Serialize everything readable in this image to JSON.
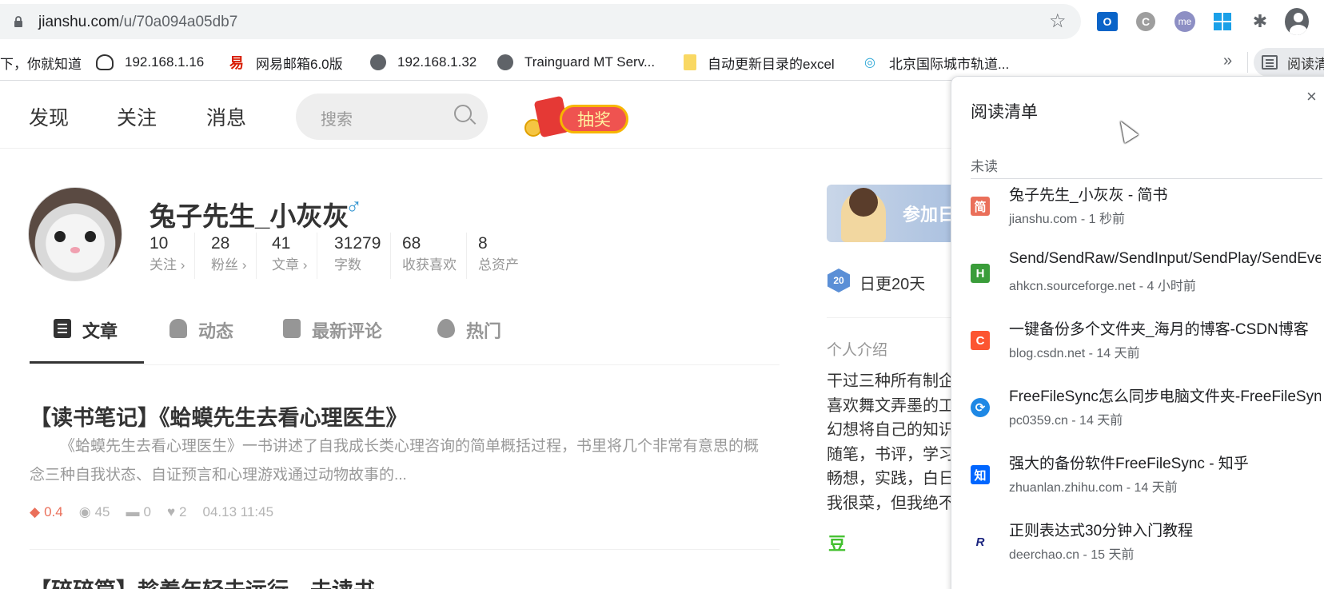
{
  "browser": {
    "url_host": "jianshu.com",
    "url_path": "/u/70a094a05db7",
    "bookmarks": [
      {
        "label": "下，你就知道",
        "icon": "none"
      },
      {
        "label": "192.168.1.16",
        "icon": "gauge-icon"
      },
      {
        "label": "网易邮箱6.0版",
        "icon": "netease-163-icon"
      },
      {
        "label": "192.168.1.32",
        "icon": "globe-icon"
      },
      {
        "label": "Trainguard MT Serv...",
        "icon": "globe-icon"
      },
      {
        "label": "自动更新目录的excel",
        "icon": "folder-icon"
      },
      {
        "label": "北京国际城市轨道...",
        "icon": "metro-icon"
      }
    ],
    "bookmarks_more": "»",
    "reading_list_button": "阅读清",
    "extensions": {
      "outlook": "O",
      "c": "C",
      "me": "me"
    }
  },
  "site": {
    "nav": {
      "discover": "发现",
      "follow": "关注",
      "messages": "消息"
    },
    "search_placeholder": "搜索",
    "lottery_label": "抽奖"
  },
  "profile": {
    "name": "兔子先生_小灰灰",
    "gender_symbol": "♂",
    "stats": [
      {
        "num": "10",
        "label": "关注 ›"
      },
      {
        "num": "28",
        "label": "粉丝 ›"
      },
      {
        "num": "41",
        "label": "文章 ›"
      },
      {
        "num": "31279",
        "label": "字数"
      },
      {
        "num": "68",
        "label": "收获喜欢"
      },
      {
        "num": "8",
        "label": "总资产"
      }
    ]
  },
  "tabs": [
    {
      "label": "文章",
      "icon": "document-icon",
      "active": true
    },
    {
      "label": "动态",
      "icon": "bell-icon",
      "active": false
    },
    {
      "label": "最新评论",
      "icon": "comment-icon",
      "active": false
    },
    {
      "label": "热门",
      "icon": "fire-icon",
      "active": false
    }
  ],
  "articles": [
    {
      "title": "【读书笔记】《蛤蟆先生去看心理医生》",
      "abstract": "《蛤蟆先生去看心理医生》一书讲述了自我成长类心理咨询的简单概括过程，书里将几个非常有意思的概念三种自我状态、自证预言和心理游戏通过动物故事的...",
      "diamond": "0.4",
      "views": "45",
      "comments": "0",
      "likes": "2",
      "time": "04.13 11:45"
    },
    {
      "title": "【碎碎篇】趁着年轻去远行，去读书"
    }
  ],
  "sidebar": {
    "banner_text": "参加日",
    "badge": "20",
    "streak": "日更20天",
    "intro_heading": "个人介绍",
    "intro_lines": [
      "干过三种所有制企",
      "喜欢舞文弄墨的工",
      "幻想将自己的知识",
      "随笔，书评，学习",
      "畅想，实践，白日",
      "我很菜，但我绝不"
    ],
    "dou": "豆"
  },
  "reading_list": {
    "title": "阅读清单",
    "close": "×",
    "section": "未读",
    "items": [
      {
        "title": "兔子先生_小灰灰 - 简书",
        "sub": "jianshu.com - 1 秒前",
        "fav": "简",
        "color": "#ea6f5a"
      },
      {
        "title": "Send/SendRaw/SendInput/SendPlay/SendEvent",
        "sub": "ahkcn.sourceforge.net - 4 小时前",
        "fav": "H",
        "color": "#3a9d3a"
      },
      {
        "title": "一键备份多个文件夹_海月的博客-CSDN博客",
        "sub": "blog.csdn.net - 14 天前",
        "fav": "C",
        "color": "#fc5531"
      },
      {
        "title": "FreeFileSync怎么同步电脑文件夹-FreeFileSync",
        "sub": "pc0359.cn - 14 天前",
        "fav": "⟳",
        "color": "#1e88e5"
      },
      {
        "title": "强大的备份软件FreeFileSync - 知乎",
        "sub": "zhuanlan.zhihu.com - 14 天前",
        "fav": "知",
        "color": "#0066ff"
      },
      {
        "title": "正则表达式30分钟入门教程",
        "sub": "deerchao.cn - 15 天前",
        "fav": "R",
        "color": "#ffffff"
      }
    ]
  }
}
